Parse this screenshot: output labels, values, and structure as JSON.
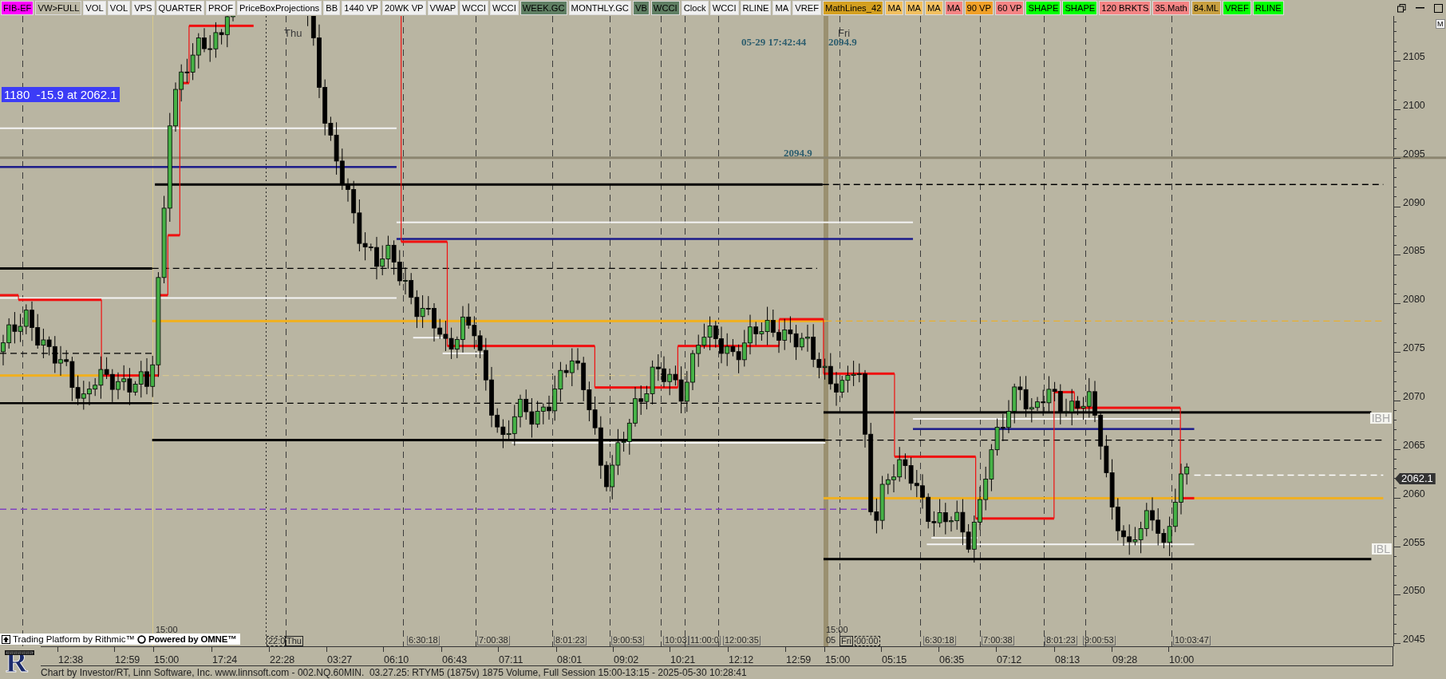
{
  "toolbar": {
    "buttons": [
      {
        "label": "FIB-EF",
        "color": "#ff00ff"
      },
      {
        "label": "VW>FULL",
        "color": "#bdb9a7"
      },
      {
        "label": "VOL",
        "color": "#f0f0f0"
      },
      {
        "label": "VOL",
        "color": "#f0f0f0"
      },
      {
        "label": "VPS",
        "color": "#f0f0f0"
      },
      {
        "label": "QUARTER",
        "color": "#f0f0f0"
      },
      {
        "label": "PROF",
        "color": "#f0f0f0"
      },
      {
        "label": "PriceBoxProjections",
        "color": "#f0f0f0"
      },
      {
        "label": "BB",
        "color": "#f0f0f0"
      },
      {
        "label": "1440 VP",
        "color": "#f0f0f0"
      },
      {
        "label": "20WK VP",
        "color": "#f0f0f0"
      },
      {
        "label": "VWAP",
        "color": "#f0f0f0"
      },
      {
        "label": "WCCI",
        "color": "#f0f0f0"
      },
      {
        "label": "WCCI",
        "color": "#f0f0f0"
      },
      {
        "label": "WEEK.GC",
        "color": "#5f7f63"
      },
      {
        "label": "MONTHLY.GC",
        "color": "#f0f0f0"
      },
      {
        "label": "VB",
        "color": "#5f7f63"
      },
      {
        "label": "WCCI",
        "color": "#5f7f63"
      },
      {
        "label": "Clock",
        "color": "#f0f0f0"
      },
      {
        "label": "WCCI",
        "color": "#f0f0f0"
      },
      {
        "label": "RLINE",
        "color": "#f0f0f0"
      },
      {
        "label": "MA",
        "color": "#f0f0f0"
      },
      {
        "label": "VREF",
        "color": "#f0f0f0"
      },
      {
        "label": "MathLines_42",
        "color": "#d4a020"
      },
      {
        "label": "MA",
        "color": "#f2c060"
      },
      {
        "label": "MA",
        "color": "#f2c060"
      },
      {
        "label": "MA",
        "color": "#f2c060"
      },
      {
        "label": "MA",
        "color": "#f48484"
      },
      {
        "label": "90 VP",
        "color": "#f0a028"
      },
      {
        "label": "60 VP",
        "color": "#f48484"
      },
      {
        "label": "SHAPE",
        "color": "#00ff00"
      },
      {
        "label": "SHAPE",
        "color": "#00ff00"
      },
      {
        "label": "120 BRKTS",
        "color": "#f48484"
      },
      {
        "label": "35.Math",
        "color": "#f48484"
      },
      {
        "label": "84.ML",
        "color": "#c8a040"
      },
      {
        "label": "VREF",
        "color": "#00ff00"
      },
      {
        "label": "RLINE",
        "color": "#00ff00"
      }
    ]
  },
  "chart": {
    "readout": "1180  -15.9 at 2062.1",
    "day_labels": [
      "Thu",
      "Fri"
    ],
    "cursor_time": "05-29 17:42:44",
    "cursor_price": "2094.9",
    "line_label": "2094.9",
    "level_tags": [
      "IBH",
      "IBL"
    ],
    "last_price": "2062.1",
    "marker": "M",
    "session_labels": [
      {
        "text": "15:00",
        "kind": "plain"
      },
      {
        "text": "22:0",
        "kind": "dashed"
      },
      {
        "text": "Thu",
        "kind": "boxed"
      },
      {
        "text": "6:30:18",
        "kind": "bracket"
      },
      {
        "text": "7:00:38",
        "kind": "bracket"
      },
      {
        "text": "8:01:23",
        "kind": "bracket"
      },
      {
        "text": "9:00:53",
        "kind": "bracket"
      },
      {
        "text": "10:03",
        "kind": "bracket"
      },
      {
        "text": "11:00:0",
        "kind": "bracket"
      },
      {
        "text": "12:00:35",
        "kind": "bracket"
      },
      {
        "text": "15:00",
        "kind": "plain"
      },
      {
        "text": "05",
        "kind": "plain"
      },
      {
        "text": "Fri",
        "kind": "boxed"
      },
      {
        "text": "00:00",
        "kind": "dashed"
      },
      {
        "text": "6:30:18",
        "kind": "bracket"
      },
      {
        "text": "7:00:38",
        "kind": "bracket"
      },
      {
        "text": "8:01:23",
        "kind": "bracket"
      },
      {
        "text": "9:00:53",
        "kind": "bracket"
      },
      {
        "text": "10:03:47",
        "kind": "bracket"
      }
    ],
    "attribution": {
      "rithmic": "Trading Platform by Rithmic™",
      "omne": "Powered by OMNE™"
    }
  },
  "price_axis": {
    "labels": [
      "2105",
      "2100",
      "2095",
      "2090",
      "2085",
      "2080",
      "2075",
      "2070",
      "2065",
      "2060",
      "2055",
      "2050",
      "2045"
    ]
  },
  "time_axis": {
    "labels": [
      "12:38",
      "12:59",
      "15:00",
      "17:24",
      "22:28",
      "03:27",
      "06:10",
      "06:43",
      "07:11",
      "08:01",
      "09:02",
      "10:21",
      "12:12",
      "12:59",
      "15:00",
      "05:15",
      "06:35",
      "07:12",
      "08:13",
      "09:28",
      "10:00"
    ]
  },
  "logo": {
    "letter": "R"
  },
  "status_bar": "Chart by Investor/RT, Linn Software, Inc. www.linnsoft.com - 002.NQ.60MIN.  03.27.25: RTYM5 (1875v) 1875 Volume, Full Session 15:00-13:15 - 2025-05-30 10:28:41"
}
